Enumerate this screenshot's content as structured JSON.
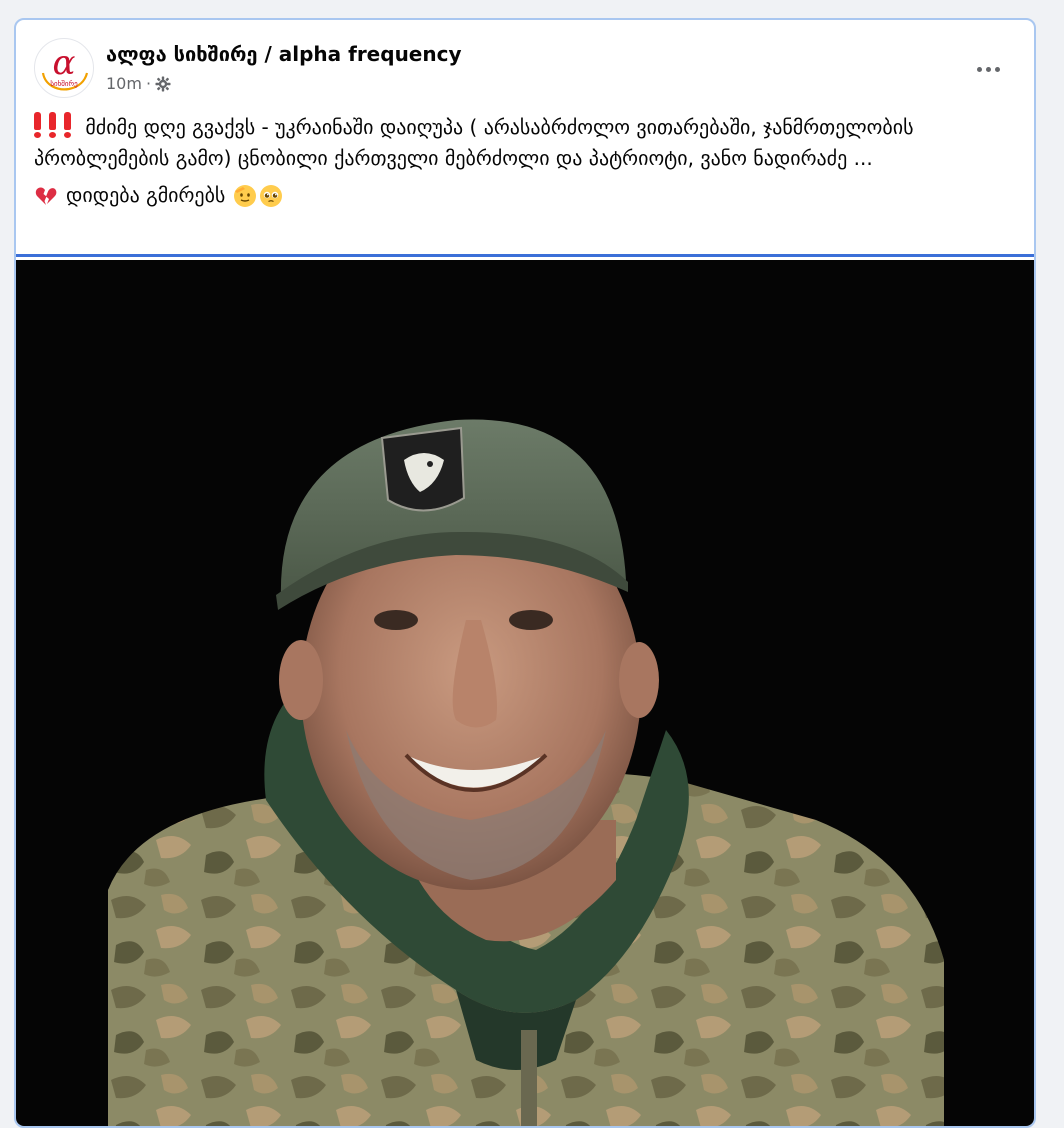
{
  "post": {
    "page_name": "ალფა სიხშირე / alpha frequency",
    "time": "10m",
    "separator": "·",
    "audience_icon": "gear-icon",
    "more_icon": "more-options-icon",
    "text_line1": "მძიმე დღე გვაქვს - უკრაინაში დაიღუპა ( არასაბრძოლო ვითარებაში, ჯანმრთელობის პრობლემების გამო)  ცნობილი ქართველი მებრძოლი და პატრიოტი, ვანო ნადირაძე ...",
    "text_line2": "დიდება გმირებს",
    "emoji_prefix": "broken-heart",
    "emoji_suffix": [
      "saluting-face",
      "pleading-face"
    ],
    "logo": {
      "letter": "α",
      "caption": "სიხშირე",
      "accent_color": "#c8102e",
      "ring_color": "#f2a100"
    },
    "photo": {
      "alt": "portrait photo"
    },
    "colors": {
      "accent": "#3b6fd8",
      "exclamation": "#e8262b",
      "card_border": "#a9c7f0"
    }
  }
}
